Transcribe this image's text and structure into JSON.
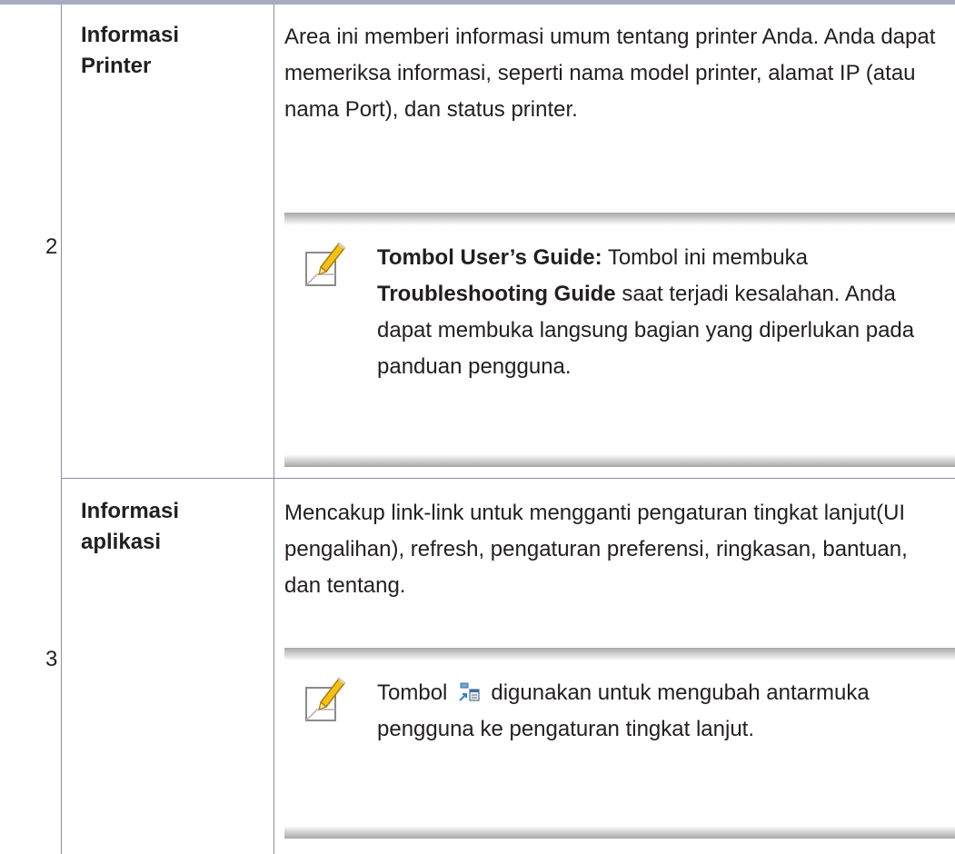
{
  "rows": [
    {
      "number": "2",
      "label": [
        "Informasi",
        "Printer"
      ],
      "description": "Area ini memberi informasi umum tentang printer Anda. Anda dapat memeriksa informasi, seperti nama model printer, alamat IP (atau nama Port), dan status printer.",
      "note": {
        "icon": "note-pencil-icon",
        "bold_lead": "Tombol User’s Guide:",
        "text1": " Tombol ini membuka ",
        "bold_mid": "Troubleshooting Guide",
        "text2": " saat terjadi kesalahan. Anda dapat membuka langsung bagian yang diperlukan pada panduan pengguna."
      }
    },
    {
      "number": "3",
      "label": [
        "Informasi",
        "aplikasi"
      ],
      "description": "Mencakup link-link untuk mengganti pengaturan tingkat lanjut(UI pengalihan), refresh, pengaturan preferensi, ringkasan, bantuan, dan tentang.",
      "note": {
        "icon": "note-pencil-icon",
        "text_before": "Tombol",
        "inline_icon": "switch-advanced-ui-icon",
        "text_after": "digunakan untuk mengubah antarmuka pengguna ke pengaturan tingkat lanjut."
      }
    }
  ]
}
